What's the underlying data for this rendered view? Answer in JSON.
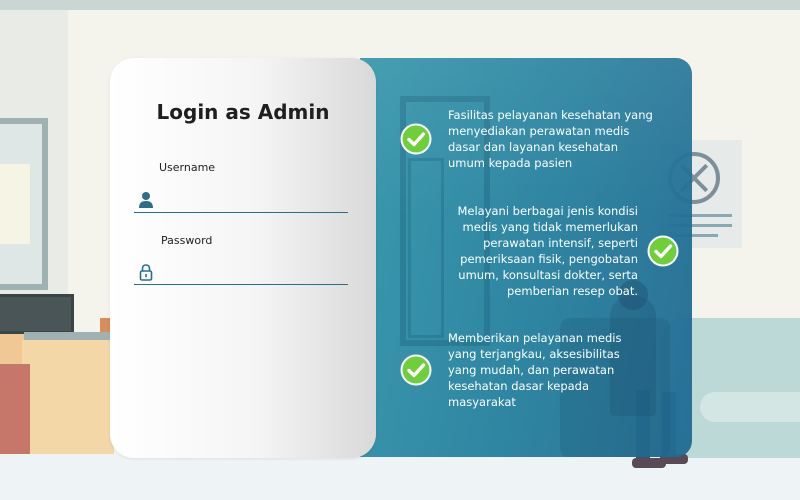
{
  "login": {
    "title": "Login as Admin",
    "username_label": "Username",
    "password_label": "Password",
    "username_value": "",
    "password_value": ""
  },
  "features": [
    {
      "text": "Fasilitas pelayanan kesehatan yang menyediakan perawatan medis dasar dan layanan kesehatan umum kepada pasien"
    },
    {
      "text": "Melayani berbagai jenis kondisi medis yang tidak memerlukan perawatan intensif, seperti pemeriksaan fisik, pengobatan umum, konsultasi dokter, serta pemberian resep obat."
    },
    {
      "text": "Memberikan pelayanan medis yang terjangkau, aksesibilitas yang mudah, dan perawatan kesehatan dasar kepada masyarakat"
    }
  ],
  "icons": {
    "username": "user-icon",
    "password": "lock-icon",
    "feature_check": "check-circle-icon"
  },
  "colors": {
    "accent": "#2a6e8c",
    "panel_teal": "#2f8fab",
    "check_green": "#6fcf3a"
  }
}
